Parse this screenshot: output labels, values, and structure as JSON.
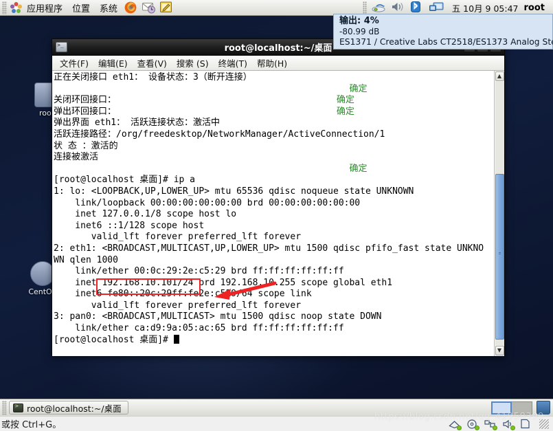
{
  "top_panel": {
    "menus": [
      {
        "label": "应用程序",
        "name": "menu-applications"
      },
      {
        "label": "位置",
        "name": "menu-places"
      },
      {
        "label": "系统",
        "name": "menu-system"
      }
    ],
    "launchers": [
      {
        "name": "firefox-icon",
        "title": "Firefox"
      },
      {
        "name": "evolution-mail-icon",
        "title": "Evolution"
      },
      {
        "name": "text-editor-icon",
        "title": "Text Editor"
      }
    ],
    "tray": [
      {
        "name": "network-icon"
      },
      {
        "name": "volume-icon"
      },
      {
        "name": "bluetooth-icon"
      },
      {
        "name": "display-icon"
      }
    ],
    "clock": "五 10月  9 05:47",
    "user": "root"
  },
  "volume_tooltip": {
    "title": "输出: 4%",
    "db": "-80.99 dB",
    "device": "ES1371 / Creative Labs CT2518/ES1373 Analog Stereo"
  },
  "desktop": {
    "icons": [
      {
        "label": "root",
        "name": "desktop-icon-root"
      },
      {
        "label": "CentOS",
        "name": "desktop-icon-centos"
      }
    ]
  },
  "terminal": {
    "title": "root@localhost:~/桌面",
    "menubar": [
      {
        "label": "文件(F)",
        "name": "term-menu-file"
      },
      {
        "label": "编辑(E)",
        "name": "term-menu-edit"
      },
      {
        "label": "查看(V)",
        "name": "term-menu-view"
      },
      {
        "label": "搜索 (S)",
        "name": "term-menu-search"
      },
      {
        "label": "终端(T)",
        "name": "term-menu-terminal"
      },
      {
        "label": "帮助(H)",
        "name": "term-menu-help"
      }
    ],
    "window_buttons": [
      {
        "glyph": "—",
        "name": "minimize-button"
      },
      {
        "glyph": "□",
        "name": "maximize-button"
      },
      {
        "glyph": "✕",
        "name": "close-button"
      }
    ],
    "lines": [
      "正在关闭接口 eth1： 设备状态：3（断开连接）",
      "                                                    [  确定  ]",
      "关闭环回接口：                                      [  确定  ]",
      "弹出环回接口：                                      [  确定  ]",
      "弹出界面 eth1： 活跃连接状态：激活中",
      "活跃连接路径：/org/freedesktop/NetworkManager/ActiveConnection/1",
      "状 态 ：激活的",
      "连接被激活",
      "                                                    [  确定  ]",
      "[root@localhost 桌面]# ip a",
      "1: lo: <LOOPBACK,UP,LOWER_UP> mtu 65536 qdisc noqueue state UNKNOWN",
      "    link/loopback 00:00:00:00:00:00 brd 00:00:00:00:00:00",
      "    inet 127.0.0.1/8 scope host lo",
      "    inet6 ::1/128 scope host",
      "       valid_lft forever preferred_lft forever",
      "2: eth1: <BROADCAST,MULTICAST,UP,LOWER_UP> mtu 1500 qdisc pfifo_fast state UNKNO",
      "WN qlen 1000",
      "    link/ether 00:0c:29:2e:c5:29 brd ff:ff:ff:ff:ff:ff",
      "    inet 192.168.10.101/24 brd 192.168.10.255 scope global eth1",
      "    inet6 fe80::20c:29ff:fe2e:c529/64 scope link",
      "       valid_lft forever preferred_lft forever",
      "3: pan0: <BROADCAST,MULTICAST> mtu 1500 qdisc noop state DOWN",
      "    link/ether ca:d9:9a:05:ac:65 brd ff:ff:ff:ff:ff:ff",
      "[root@localhost 桌面]# "
    ],
    "highlight_value": "192.168.10.101/24",
    "highlight_color": "#ee2222"
  },
  "taskbar": {
    "task_label": "root@localhost:~/桌面",
    "workspaces": 2,
    "trash_name": "trash-icon"
  },
  "status_strip": {
    "hint": "或按 Ctrl+G。",
    "icons": [
      {
        "name": "vm-network-icon"
      },
      {
        "name": "vm-cdrom-icon"
      },
      {
        "name": "vm-usb-icon"
      },
      {
        "name": "vm-sound-icon"
      },
      {
        "name": "vm-printer-icon"
      }
    ]
  },
  "watermark": "https://blog.csdn.net/qq_41958399"
}
